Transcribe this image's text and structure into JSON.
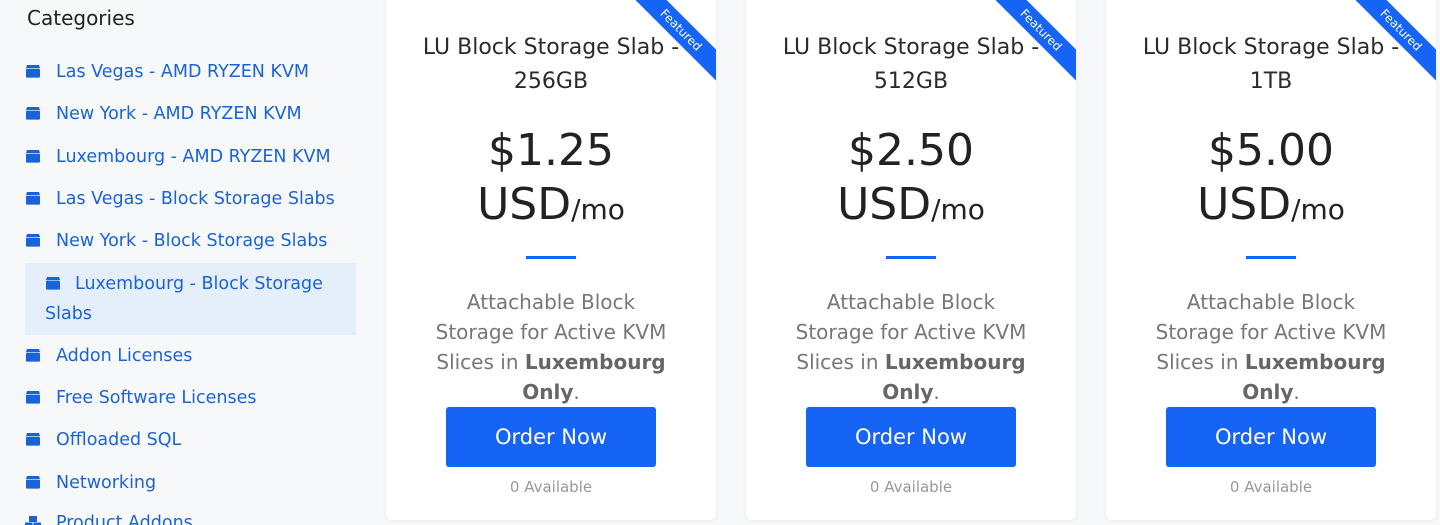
{
  "sidebar": {
    "title": "Categories",
    "items": [
      {
        "label": "Las Vegas - AMD RYZEN KVM",
        "icon": "box-icon"
      },
      {
        "label": "New York - AMD RYZEN KVM",
        "icon": "box-icon"
      },
      {
        "label": "Luxembourg - AMD RYZEN KVM",
        "icon": "box-icon"
      },
      {
        "label": "Las Vegas - Block Storage Slabs",
        "icon": "box-icon"
      },
      {
        "label": "New York - Block Storage Slabs",
        "icon": "box-icon"
      },
      {
        "label": "Luxembourg - Block Storage Slabs",
        "icon": "box-icon",
        "active": true
      },
      {
        "label": "Addon Licenses",
        "icon": "box-icon"
      },
      {
        "label": "Free Software Licenses",
        "icon": "box-icon"
      },
      {
        "label": "Offloaded SQL",
        "icon": "box-icon"
      },
      {
        "label": "Networking",
        "icon": "box-icon"
      },
      {
        "label": "Product Addons",
        "icon": "cubes-icon"
      }
    ]
  },
  "products": [
    {
      "ribbon": "Featured",
      "title": "LU Block Storage Slab - 256GB",
      "price": "$1.25 USD",
      "period": "/mo",
      "desc_pre": "Attachable Block Storage for Active KVM Slices in",
      "desc_bold": "Luxembourg Only",
      "desc_post": ".",
      "button": "Order Now",
      "available": "0 Available"
    },
    {
      "ribbon": "Featured",
      "title": "LU Block Storage Slab - 512GB",
      "price": "$2.50 USD",
      "period": "/mo",
      "desc_pre": "Attachable Block Storage for Active KVM Slices in",
      "desc_bold": "Luxembourg Only",
      "desc_post": ".",
      "button": "Order Now",
      "available": "0 Available"
    },
    {
      "ribbon": "Featured",
      "title": "LU Block Storage Slab - 1TB",
      "price": "$5.00 USD",
      "period": "/mo",
      "desc_pre": "Attachable Block Storage for Active KVM Slices in",
      "desc_bold": "Luxembourg Only",
      "desc_post": ".",
      "button": "Order Now",
      "available": "0 Available"
    }
  ],
  "colors": {
    "accent": "#1564f5",
    "link": "#1a63d6",
    "active_bg": "#e5effc",
    "page_bg": "#f7f8fa"
  }
}
